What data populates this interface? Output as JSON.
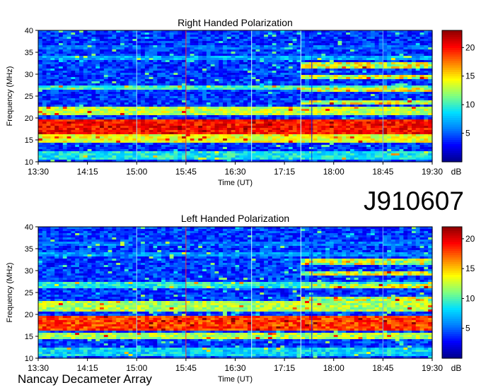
{
  "figure": {
    "observation_id": "J910607",
    "instrument": "Nancay Decameter Array"
  },
  "colors": {
    "colormap": [
      "#00008b",
      "#0000ff",
      "#0080ff",
      "#00e0ff",
      "#7fff7f",
      "#ffff00",
      "#ff8000",
      "#ff0000",
      "#8b0000"
    ]
  },
  "chart_data": [
    {
      "type": "heatmap",
      "title": "Right Handed Polarization",
      "xlabel": "Time (UT)",
      "ylabel": "Frequency (MHz)",
      "x_ticks": [
        "13:30",
        "14:15",
        "15:00",
        "15:45",
        "16:30",
        "17:15",
        "18:00",
        "18:45",
        "19:30"
      ],
      "y_ticks": [
        "10",
        "15",
        "20",
        "25",
        "30",
        "35",
        "40"
      ],
      "xlim": [
        "13:30",
        "19:30"
      ],
      "ylim": [
        10,
        40
      ],
      "colorbar": {
        "label": "dB",
        "ticks": [
          "5",
          "10",
          "15",
          "20"
        ],
        "range": [
          0,
          23
        ]
      },
      "emission_bands_mhz": [
        {
          "low": 10.5,
          "high": 12.5,
          "level": 11
        },
        {
          "low": 14.5,
          "high": 16.2,
          "level": 16
        },
        {
          "low": 16.4,
          "high": 19.6,
          "level": 22
        },
        {
          "low": 20.5,
          "high": 22.5,
          "level": 15
        },
        {
          "low": 26.5,
          "high": 27.5,
          "level": 12
        },
        {
          "low": 33.0,
          "high": 34.0,
          "level": 9
        },
        {
          "low": 35.5,
          "high": 36.5,
          "level": 7
        }
      ],
      "late_activity": {
        "start": "17:30",
        "low_mhz": 22,
        "high_mhz": 33,
        "level": 17
      }
    },
    {
      "type": "heatmap",
      "title": "Left Handed Polarization",
      "xlabel": "Time (UT)",
      "ylabel": "Frequency (MHz)",
      "x_ticks": [
        "13:30",
        "14:15",
        "15:00",
        "15:45",
        "16:30",
        "17:15",
        "18:00",
        "18:45",
        "19:30"
      ],
      "y_ticks": [
        "10",
        "15",
        "20",
        "25",
        "30",
        "35",
        "40"
      ],
      "xlim": [
        "13:30",
        "19:30"
      ],
      "ylim": [
        10,
        40
      ],
      "colorbar": {
        "label": "dB",
        "ticks": [
          "5",
          "10",
          "15",
          "20"
        ],
        "range": [
          0,
          22
        ]
      },
      "emission_bands_mhz": [
        {
          "low": 10.5,
          "high": 12.5,
          "level": 10
        },
        {
          "low": 14.5,
          "high": 16.0,
          "level": 14
        },
        {
          "low": 16.2,
          "high": 19.8,
          "level": 20
        },
        {
          "low": 20.5,
          "high": 23.0,
          "level": 14
        },
        {
          "low": 26.0,
          "high": 27.5,
          "level": 11
        },
        {
          "low": 33.0,
          "high": 34.0,
          "level": 8
        },
        {
          "low": 35.5,
          "high": 36.5,
          "level": 7
        }
      ],
      "late_activity": {
        "start": "17:30",
        "low_mhz": 22,
        "high_mhz": 33,
        "level": 16
      }
    }
  ]
}
